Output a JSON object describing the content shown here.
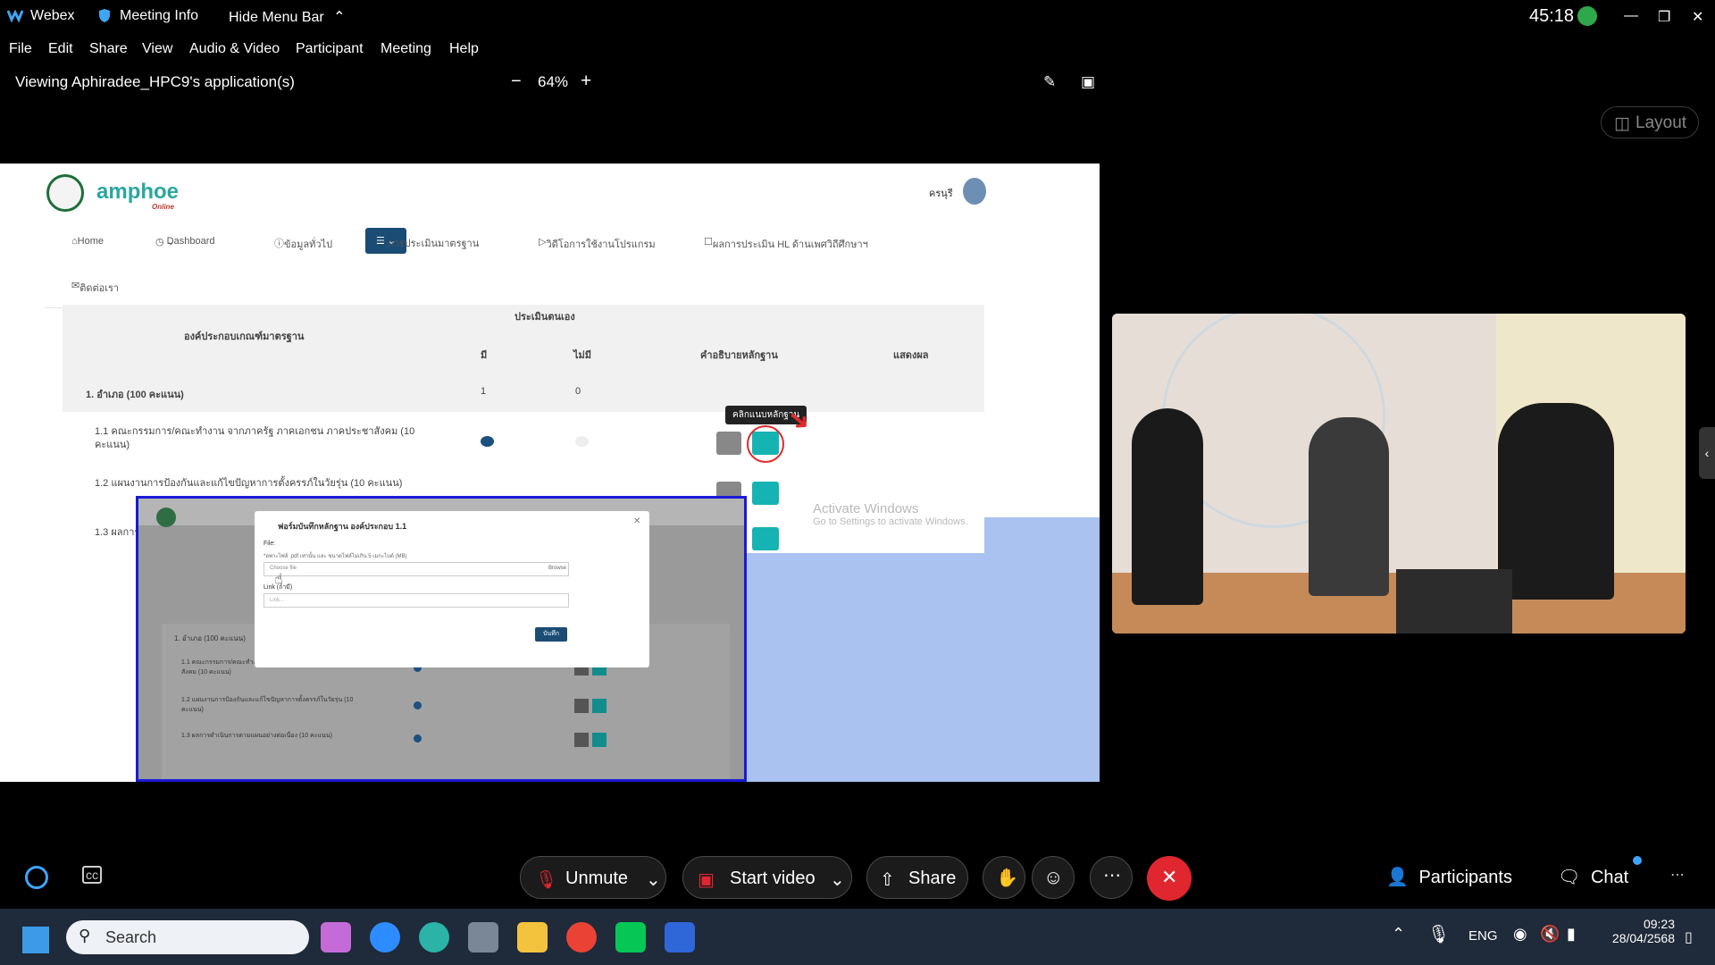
{
  "titlebar": {
    "app": "Webex",
    "meeting_info": "Meeting Info",
    "hide_menu": "Hide Menu Bar",
    "timer": "45:18"
  },
  "menu": [
    "File",
    "Edit",
    "Share",
    "View",
    "Audio & Video",
    "Participant",
    "Meeting",
    "Help"
  ],
  "viewbar": {
    "title": "Viewing Aphiradee_HPC9's application(s)",
    "zoom": "64%",
    "layout": "Layout"
  },
  "site": {
    "brand": "amphoe",
    "brand_sub": "Online",
    "user": "ครนุรี",
    "nav": [
      "Home",
      "Dashboard",
      "ข้อมูลทั่วไป",
      "การประเมินมาตรฐาน",
      "วิดีโอการใช้งานโปรแกรม",
      "ผลการประเมิน HL ด้านเพศวิถีศึกษาฯ",
      "ติดต่อเรา"
    ],
    "table": {
      "col_main": "องค์ประกอบเกณฑ์มาตรฐาน",
      "col_self": "ประเมินตนเอง",
      "col_yes": "มี",
      "col_no": "ไม่มี",
      "col_desc": "คำอธิบายหลักฐาน",
      "col_result": "แสดงผล",
      "section": "1. อำเภอ (100 คะแนน)",
      "section_yes": "1",
      "section_no": "0",
      "rows": [
        "1.1 คณะกรรมการ/คณะทำงาน จากภาครัฐ ภาคเอกชน ภาคประชาสังคม (10 คะแนน)",
        "1.2 แผนงานการป้องกันและแก้ไขปัญหาการตั้งครรภ์ในวัยรุ่น (10 คะแนน)",
        "1.3 ผลการ"
      ],
      "tooltip": "คลิกแนบหลักฐาน"
    },
    "activate": {
      "title": "Activate Windows",
      "sub": "Go to Settings to activate Windows."
    }
  },
  "modal": {
    "title": "ฟอร์มบันทึกหลักฐาน องค์ประกอบ 1.1",
    "file_label": "File:",
    "file_hint": "*อพาะไฟล์ .pdf เท่านั้น และ ขนาดไฟล์ไม่เกิน 5 เมกะไบต์ (MB)",
    "choose": "Choose file",
    "browse": "Browse",
    "link_label": "Link (ถ้ามี)",
    "link_placeholder": "Link...",
    "save": "บันทึก"
  },
  "overlay_rows": [
    "1. อำเภอ (100 คะแนน)",
    "1.1 คณะกรรมการ/คณะทำงาน จากภาครัฐ ภาคเอกชน ภาคประชาสังคม (10 คะแนน)",
    "1.2 แผนงานการป้องกันและแก้ไขปัญหาการตั้งครรภ์ในวัยรุ่น (10 คะแนน)",
    "1.3 ผลการดำเนินการตามแผนอย่างต่อเนื่อง (10 คะแนน)"
  ],
  "controls": {
    "unmute": "Unmute",
    "start_video": "Start video",
    "share": "Share",
    "participants": "Participants",
    "chat": "Chat"
  },
  "taskbar": {
    "search": "Search",
    "lang": "ENG",
    "time": "09:23",
    "date": "28/04/2568"
  },
  "colors": {
    "active_nav": "#1b4c74",
    "link_button": "#16b3b3",
    "end_call": "#e0262f",
    "overlay_border": "#1a1ad6",
    "blue_area": "#a9c2ef"
  }
}
